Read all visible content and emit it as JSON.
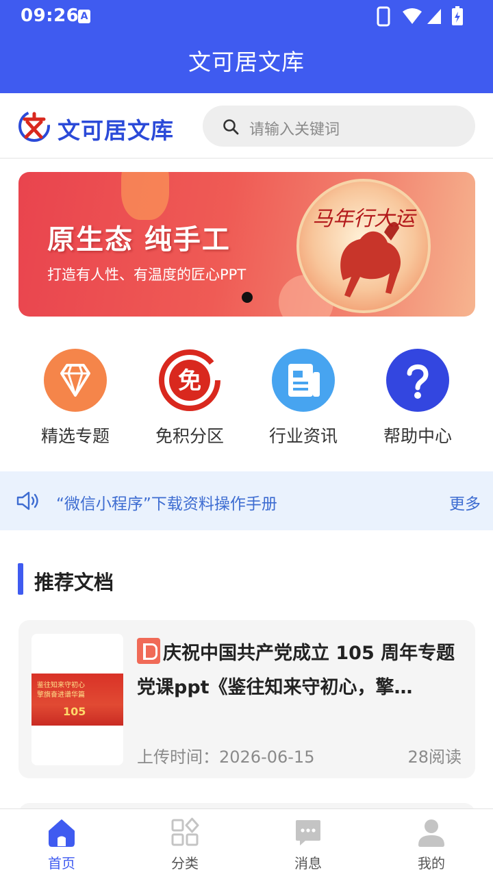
{
  "status_bar": {
    "time": "09:26",
    "notification_icon": "A"
  },
  "app_bar": {
    "title": "文可居文库"
  },
  "header": {
    "logo_text": "文可居文库",
    "search_placeholder": "请输入关键词"
  },
  "banner": {
    "headline": "原生态   纯手工",
    "subline": "打造有人性、有温度的匠心PPT",
    "art_text": "马年行大运",
    "pages": 1,
    "current_page": 1
  },
  "quick_menu": [
    {
      "label": "精选专题",
      "icon": "diamond-icon",
      "color": "#f5854a"
    },
    {
      "label": "免积分区",
      "icon": "free-badge-icon",
      "color": "#d9281e"
    },
    {
      "label": "行业资讯",
      "icon": "news-icon",
      "color": "#47a4f0"
    },
    {
      "label": "帮助中心",
      "icon": "help-icon",
      "color": "#3346e0"
    }
  ],
  "notice": {
    "text": "“微信小程序”下载资料操作手册",
    "more": "更多"
  },
  "section": {
    "title": "推荐文档"
  },
  "documents": [
    {
      "title": "庆祝中国共产党成立 105 周年专题党课ppt《鉴往知来守初心，擎…",
      "upload_label": "上传时间：2026-06-15",
      "reads": "28阅读",
      "file_type_icon": "ppt-icon",
      "thumb_line1": "鉴往知来守初心",
      "thumb_line2": "擎旗奋进谱华篇",
      "thumb_number": "105"
    }
  ],
  "tab_bar": [
    {
      "label": "首页",
      "icon": "home-icon",
      "active": true
    },
    {
      "label": "分类",
      "icon": "category-icon",
      "active": false
    },
    {
      "label": "消息",
      "icon": "message-icon",
      "active": false
    },
    {
      "label": "我的",
      "icon": "profile-icon",
      "active": false
    }
  ],
  "colors": {
    "primary": "#3f5bf0",
    "notice_bg": "#eaf2fd",
    "notice_text": "#3d6cd1"
  }
}
